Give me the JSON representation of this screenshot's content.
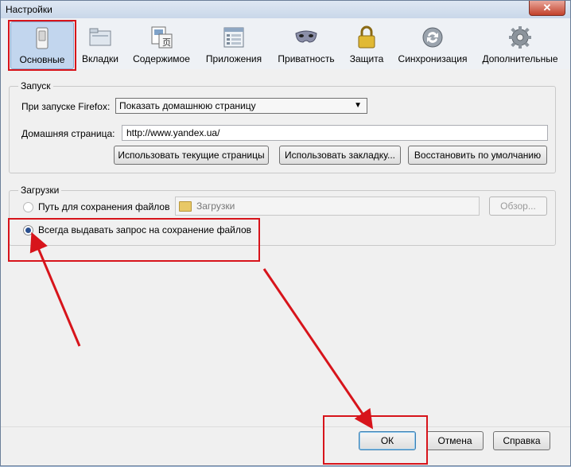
{
  "window": {
    "title": "Настройки",
    "close_label": "✕"
  },
  "toolbar": {
    "items": [
      {
        "label": "Основные",
        "icon": "general-switch-icon"
      },
      {
        "label": "Вкладки",
        "icon": "tabs-folder-icon"
      },
      {
        "label": "Содержимое",
        "icon": "content-page-icon"
      },
      {
        "label": "Приложения",
        "icon": "applications-list-icon"
      },
      {
        "label": "Приватность",
        "icon": "privacy-mask-icon"
      },
      {
        "label": "Защита",
        "icon": "security-lock-icon"
      },
      {
        "label": "Синхронизация",
        "icon": "sync-icon"
      },
      {
        "label": "Дополнительные",
        "icon": "advanced-gear-icon"
      }
    ],
    "selected": "Основные"
  },
  "startup": {
    "group_title": "Запуск",
    "on_start_label": "При запуске Firefox:",
    "on_start_value": "Показать домашнюю страницу",
    "homepage_label": "Домашняя страница:",
    "homepage_value": "http://www.yandex.ua/",
    "use_current_label": "Использовать текущие страницы",
    "use_bookmark_label": "Использовать закладку...",
    "restore_default_label": "Восстановить по умолчанию"
  },
  "downloads": {
    "group_title": "Загрузки",
    "save_path_label": "Путь для сохранения файлов",
    "save_path_value": "Загрузки",
    "browse_label": "Обзор...",
    "always_ask_label": "Всегда выдавать запрос на сохранение файлов",
    "selected_option": "always_ask"
  },
  "footer": {
    "ok_label": "ОК",
    "cancel_label": "Отмена",
    "help_label": "Справка"
  },
  "colors": {
    "annotation_red": "#d7141b",
    "selected_tab_bg": "#c2d6ee",
    "radio_dot": "#2a4f8f"
  }
}
